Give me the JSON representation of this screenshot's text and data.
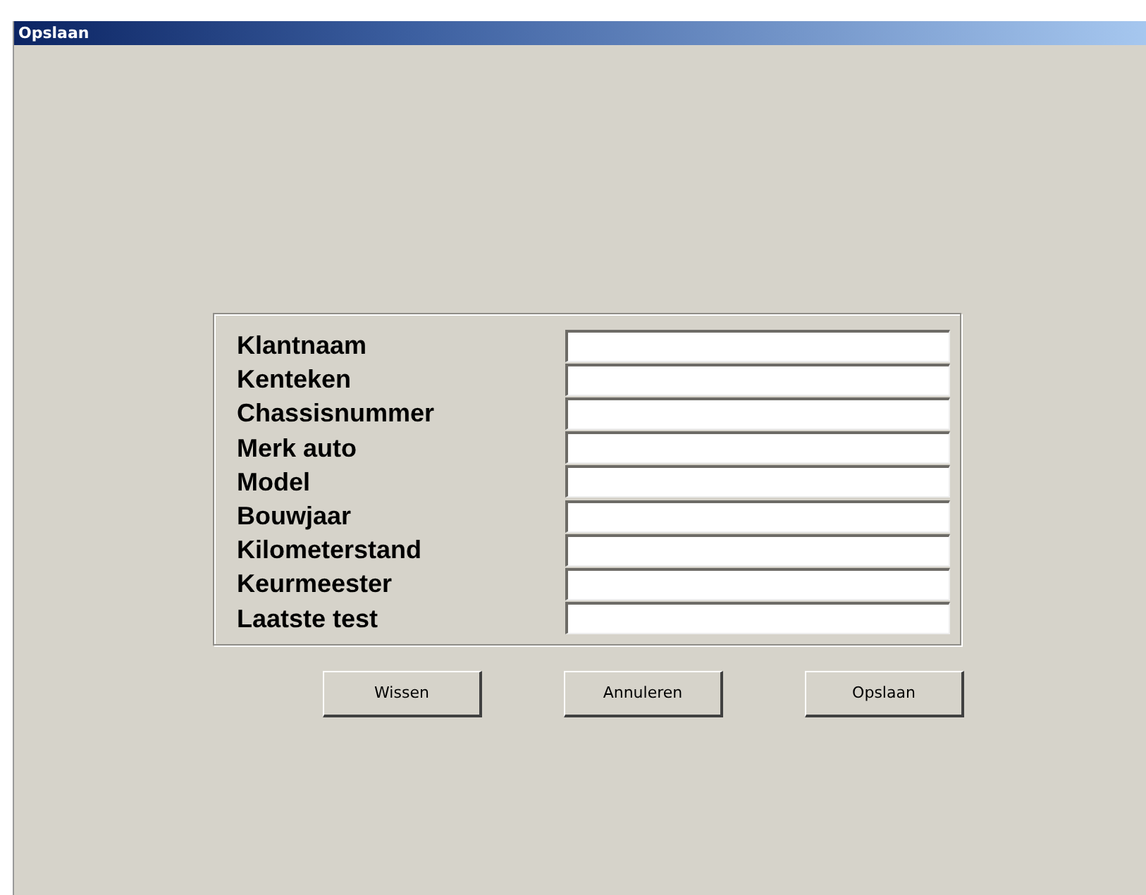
{
  "window": {
    "title": "Opslaan"
  },
  "fields": [
    {
      "label": "Klantnaam"
    },
    {
      "label": "Kenteken"
    },
    {
      "label": "Chassisnummer"
    },
    {
      "label": "Merk auto"
    },
    {
      "label": "Model"
    },
    {
      "label": "Bouwjaar"
    },
    {
      "label": "Kilometerstand"
    },
    {
      "label": "Keurmeester"
    },
    {
      "label": "Laatste test"
    }
  ],
  "buttons": [
    "Wissen",
    "Annuleren",
    "Opslaan"
  ]
}
